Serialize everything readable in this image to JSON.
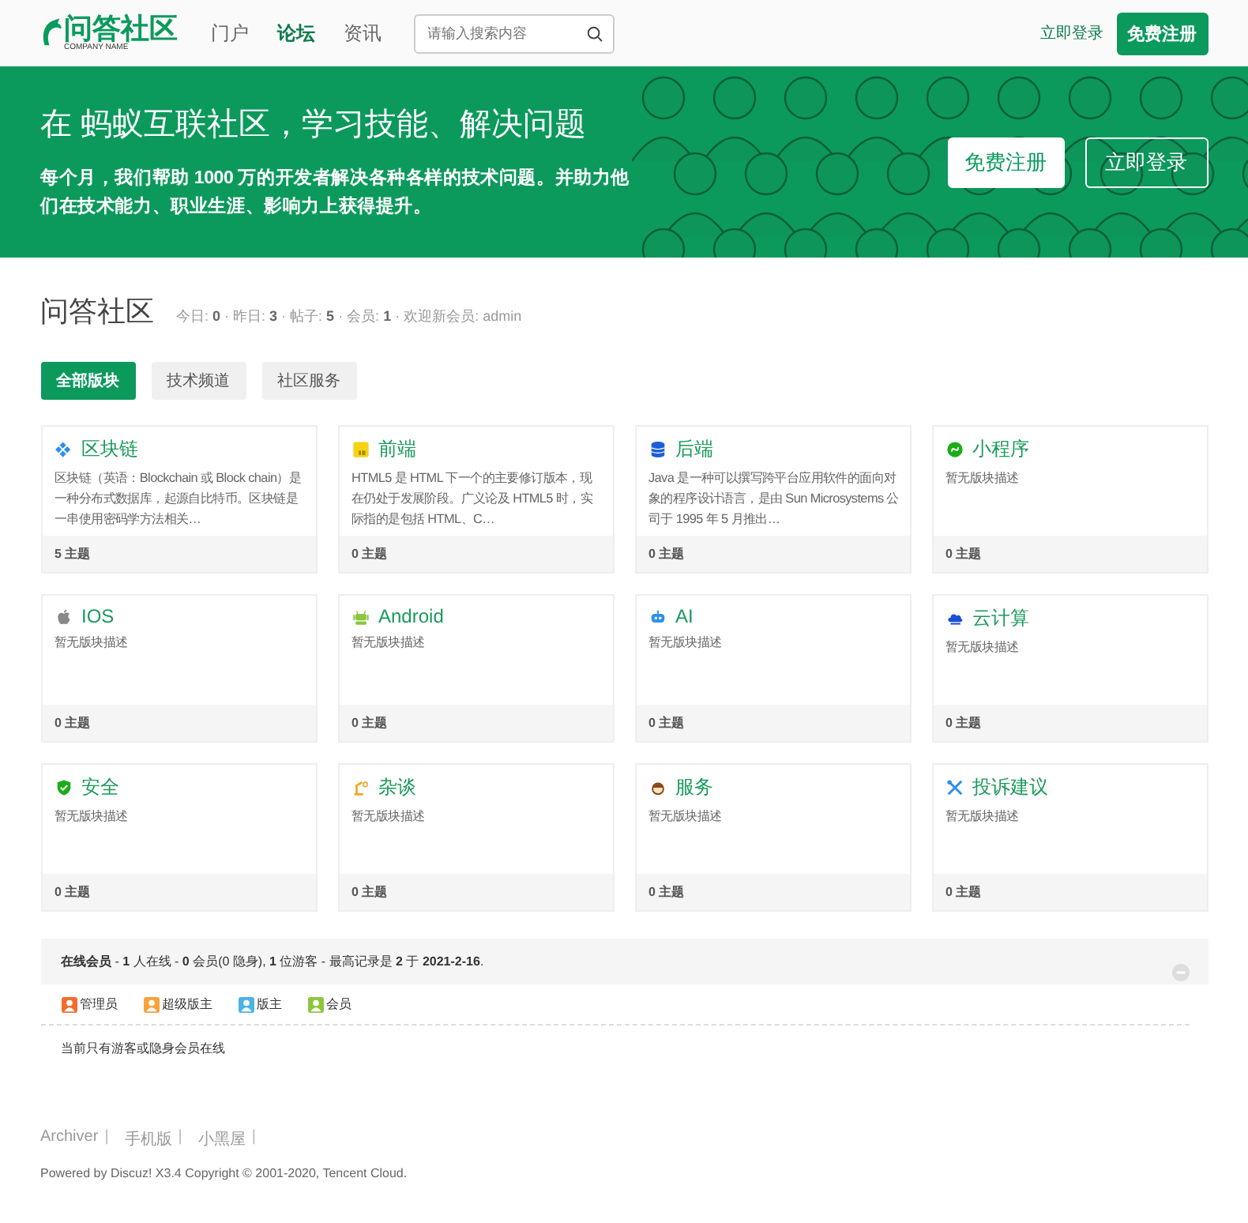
{
  "header": {
    "logo": {
      "title": "问答社区",
      "subtitle": "COMPANY NAME"
    },
    "nav": [
      {
        "label": "门户",
        "selected": false
      },
      {
        "label": "论坛",
        "selected": true
      },
      {
        "label": "资讯",
        "selected": false
      }
    ],
    "search": {
      "placeholder": "请输入搜索内容"
    },
    "login": "立即登录",
    "register": "免费注册"
  },
  "banner": {
    "title": "在 蚂蚁互联社区，学习技能、解决问题",
    "text": "每个月，我们帮助 1000 万的开发者解决各种各样的技术问题。并助力他们在技术能力、职业生涯、影响力上获得提升。",
    "register": "免费注册",
    "login": "立即登录"
  },
  "forum": {
    "title": "问答社区",
    "stats": "今日: **0** · 昨日: **3** · 帖子: **5** · 会员: **1** · 欢迎新会员: admin",
    "tabs": [
      {
        "label": "全部版块",
        "selected": true
      },
      {
        "label": "技术频道",
        "selected": false
      },
      {
        "label": "社区服务",
        "selected": false
      }
    ],
    "boards": [
      {
        "name": "区块链",
        "description": "区块链（英语：Blockchain 或 Block chain）是一种分布式数据库，起源自比特币。区块链是一串使用密码学方法相关…",
        "count": "5 主题"
      },
      {
        "name": "前端",
        "description": "HTML5 是 HTML 下一个的主要修订版本，现在仍处于发展阶段。广义论及 HTML5 时，实际指的是包括 HTML、C…",
        "count": "0 主题"
      },
      {
        "name": "后端",
        "description": "Java 是一种可以撰写跨平台应用软件的面向对象的程序设计语言，是由 Sun Microsystems 公司于 1995 年 5 月推出…",
        "count": "0 主题"
      },
      {
        "name": "小程序",
        "description": "暂无版块描述",
        "count": "0 主题"
      },
      {
        "name": "IOS",
        "description": "暂无版块描述",
        "count": "0 主题"
      },
      {
        "name": "Android",
        "description": "暂无版块描述",
        "count": "0 主题"
      },
      {
        "name": "AI",
        "description": "暂无版块描述",
        "count": "0 主题"
      },
      {
        "name": "云计算",
        "description": "暂无版块描述",
        "count": "0 主题"
      },
      {
        "name": "安全",
        "description": "暂无版块描述",
        "count": "0 主题"
      },
      {
        "name": "杂谈",
        "description": "暂无版块描述",
        "count": "0 主题"
      },
      {
        "name": "服务",
        "description": "暂无版块描述",
        "count": "0 主题"
      },
      {
        "name": "投诉建议",
        "description": "暂无版块描述",
        "count": "0 主题"
      }
    ]
  },
  "online": {
    "summary": "**在线会员** - **1** 人在线 - **0** 会员(0 隐身), **1** 位游客 - 最高记录是 **2** 于 **2021-2-16**.",
    "legend": [
      {
        "label": "管理员",
        "color": "#f26c2e"
      },
      {
        "label": "超级版主",
        "color": "#f5a33a"
      },
      {
        "label": "版主",
        "color": "#4ab3e8"
      },
      {
        "label": "会员",
        "color": "#8cc63f"
      }
    ],
    "note": "当前只有游客或隐身会员在线"
  },
  "footer": {
    "links": [
      "Archiver",
      "手机版",
      "小黑屋"
    ],
    "separator": "|",
    "copyright": "Powered by Discuz! X3.4 Copyright © 2001-2020, Tencent Cloud."
  }
}
